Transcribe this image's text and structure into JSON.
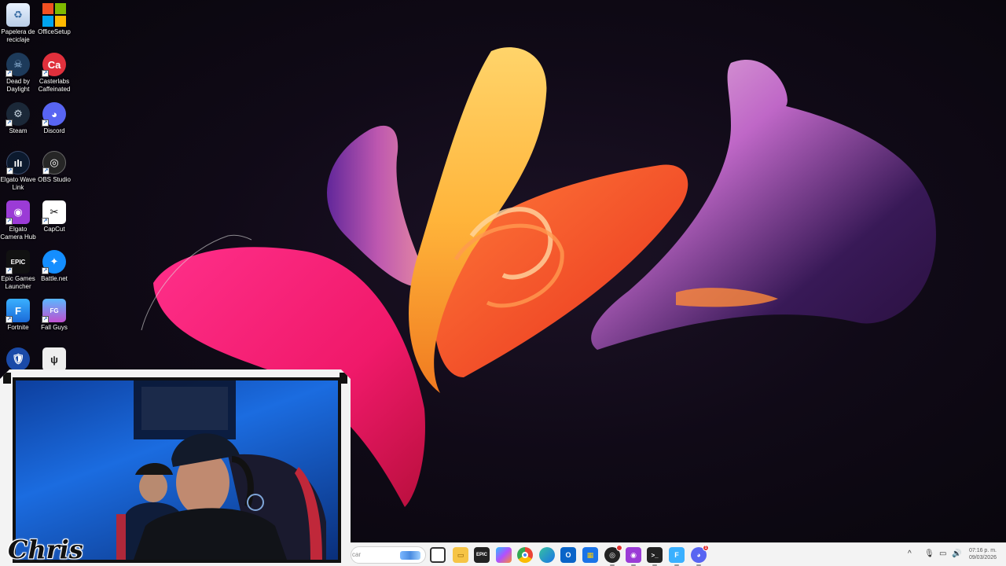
{
  "desktop": {
    "icons": [
      {
        "label": "Papelera de reciclaje",
        "icon": "recycle-bin-icon"
      },
      {
        "label": "OfficeSetup",
        "icon": "microsoft-office-icon"
      },
      {
        "label": "Dead by Daylight",
        "icon": "dead-by-daylight-icon"
      },
      {
        "label": "Casterlabs Caffeinated",
        "icon": "casterlabs-icon"
      },
      {
        "label": "Steam",
        "icon": "steam-icon"
      },
      {
        "label": "Discord",
        "icon": "discord-icon"
      },
      {
        "label": "Elgato Wave Link",
        "icon": "elgato-wave-link-icon"
      },
      {
        "label": "OBS Studio",
        "icon": "obs-studio-icon"
      },
      {
        "label": "Elgato Camera Hub",
        "icon": "elgato-camera-hub-icon"
      },
      {
        "label": "CapCut",
        "icon": "capcut-icon"
      },
      {
        "label": "Epic Games Launcher",
        "icon": "epic-games-icon"
      },
      {
        "label": "Battle.net",
        "icon": "battlenet-icon"
      },
      {
        "label": "Fortnite",
        "icon": "fortnite-icon"
      },
      {
        "label": "Fall Guys",
        "icon": "fall-guys-icon"
      },
      {
        "label": "",
        "icon": "rocket-league-icon"
      },
      {
        "label": "",
        "icon": "watch-dogs-icon"
      }
    ]
  },
  "webcam": {
    "name_overlay": "Chris"
  },
  "taskbar": {
    "search_text": "car",
    "apps": [
      {
        "name": "task-view-icon"
      },
      {
        "name": "file-explorer-icon"
      },
      {
        "name": "epic-games-icon"
      },
      {
        "name": "copilot-icon"
      },
      {
        "name": "chrome-icon"
      },
      {
        "name": "edge-icon"
      },
      {
        "name": "outlook-icon"
      },
      {
        "name": "microsoft-store-icon"
      },
      {
        "name": "obs-studio-icon"
      },
      {
        "name": "elgato-camera-hub-icon"
      },
      {
        "name": "terminal-icon"
      },
      {
        "name": "fortnite-icon"
      },
      {
        "name": "discord-icon"
      }
    ],
    "discord_badge": "1",
    "clock": {
      "time": "07:16 p. m.",
      "date": "09/03/2026"
    }
  },
  "colors": {
    "taskbar_bg": "#f3f3f3",
    "webcam_frame": "#f3f3f3",
    "webcam_bg": "#1b6ce0"
  }
}
